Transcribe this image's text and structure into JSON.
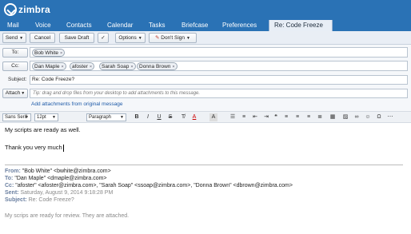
{
  "app": {
    "brand": "zimbra"
  },
  "tabs": [
    {
      "label": "Mail",
      "active": false
    },
    {
      "label": "Voice",
      "active": false
    },
    {
      "label": "Contacts",
      "active": false
    },
    {
      "label": "Calendar",
      "active": false
    },
    {
      "label": "Tasks",
      "active": false
    },
    {
      "label": "Briefcase",
      "active": false
    },
    {
      "label": "Preferences",
      "active": false
    },
    {
      "label": "Re: Code Freeze",
      "active": true
    }
  ],
  "toolbar": {
    "send": "Send",
    "cancel": "Cancel",
    "save_draft": "Save Draft",
    "options": "Options",
    "dont_sign": "Don't Sign"
  },
  "to": {
    "label": "To:",
    "recipients": [
      "Bob White"
    ]
  },
  "cc": {
    "label": "Cc:",
    "recipients": [
      "Dan Maple",
      "afoster",
      "Sarah Soap",
      "Donna Brown"
    ]
  },
  "subject": {
    "label": "Subject:",
    "value": "Re: Code Freeze?"
  },
  "attach": {
    "label": "Attach",
    "placeholder": "Tip: drag and drop files from your desktop to add attachments to this message.",
    "link": "Add attachments from original message"
  },
  "format": {
    "font": "Sans Serif",
    "size": "12pt",
    "paragraph": "Paragraph"
  },
  "body": {
    "line1": "My scripts are ready as well.",
    "line2": "Thank you very much",
    "quoted": {
      "from_label": "From:",
      "from": "\"Bob White\" <bwhite@zimbra.com>",
      "to_label": "To:",
      "to": "\"Dan Maple\" <dmaple@zimbra.com>",
      "cc_label": "Cc:",
      "cc": "\"afoster\" <afoster@zimbra.com>, \"Sarah Soap\" <ssoap@zimbra.com>, \"Donna Brown\" <dbrown@zimbra.com>",
      "sent_label": "Sent:",
      "sent": "Saturday, August 9, 2014 9:18:28 PM",
      "subject_label": "Subject:",
      "subject": "Re: Code Freeze?",
      "text": "My scrips are ready for review. They are attached."
    }
  }
}
